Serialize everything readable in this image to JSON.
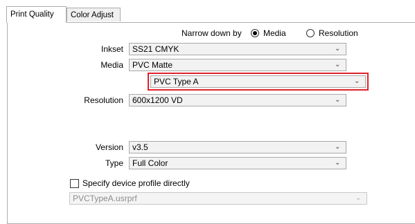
{
  "tabs": [
    {
      "label": "Print Quality",
      "active": true
    },
    {
      "label": "Color Adjust",
      "active": false
    }
  ],
  "narrow": {
    "label": "Narrow down by",
    "options": [
      {
        "label": "Media",
        "checked": true
      },
      {
        "label": "Resolution",
        "checked": false
      }
    ]
  },
  "inkset": {
    "label": "Inkset",
    "value": "SS21 CMYK"
  },
  "media": {
    "label": "Media",
    "value": "PVC Matte"
  },
  "media_type": {
    "value": "PVC Type A"
  },
  "resolution": {
    "label": "Resolution",
    "value": "600x1200 VD"
  },
  "version": {
    "label": "Version",
    "value": "v3.5"
  },
  "type": {
    "label": "Type",
    "value": "Full Color"
  },
  "device_profile": {
    "label": "Specify device profile directly",
    "checked": false,
    "value": "PVCTypeA.usrprf"
  },
  "colors": {
    "highlight": "#e0202a",
    "border": "#adadad",
    "combo_bg": "#f2f2f2"
  },
  "icons": {
    "dropdown": "chevron-down-icon"
  }
}
